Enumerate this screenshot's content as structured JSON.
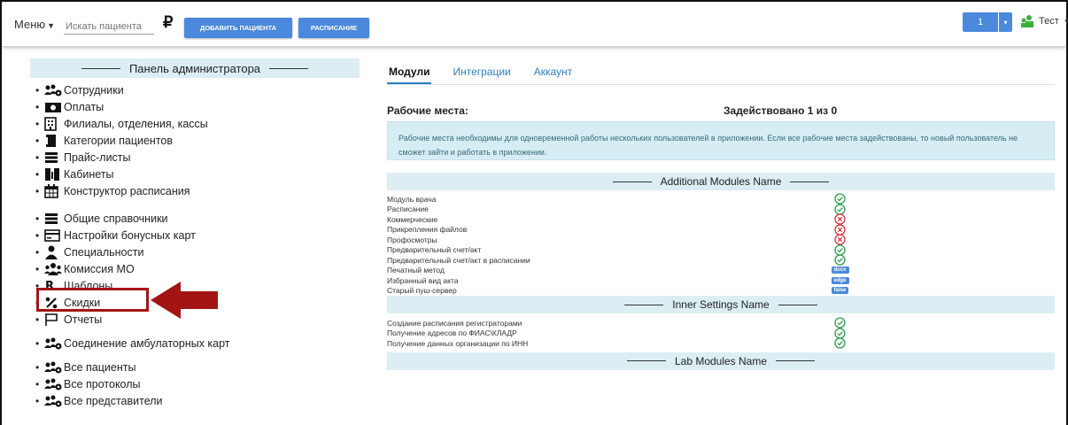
{
  "topbar": {
    "menu_label": "Меню",
    "search_placeholder": "Искать пациента",
    "currency_symbol": "₽",
    "add_patient_label": "ДОБАВИТЬ ПАЦИЕНТА",
    "schedule_label": "РАСПИСАНИЕ",
    "counter_value": "1",
    "user_name": "Тест"
  },
  "sidebar": {
    "title": "Панель администратора",
    "items": [
      {
        "label": "Сотрудники",
        "icon": "users-cog-icon"
      },
      {
        "label": "Оплаты",
        "icon": "money-icon"
      },
      {
        "label": "Филиалы, отделения, кассы",
        "icon": "building-icon"
      },
      {
        "label": "Категории пациентов",
        "icon": "file-icon"
      },
      {
        "label": "Прайс-листы",
        "icon": "list-icon"
      },
      {
        "label": "Кабинеты",
        "icon": "door-icon"
      },
      {
        "label": "Конструктор расписания",
        "icon": "calendar-icon"
      },
      {
        "label": "Общие справочники",
        "icon": "list-icon"
      },
      {
        "label": "Настройки бонусных карт",
        "icon": "card-icon"
      },
      {
        "label": "Специальности",
        "icon": "doctor-icon"
      },
      {
        "label": "Комиссия МО",
        "icon": "users-icon"
      },
      {
        "label": "Шаблоны",
        "icon": "prescription-icon"
      },
      {
        "label": "Скидки",
        "icon": "percent-icon"
      },
      {
        "label": "Отчеты",
        "icon": "flag-icon"
      },
      {
        "label": "Соединение амбулаторных карт",
        "icon": "users-cog-icon"
      },
      {
        "label": "Все пациенты",
        "icon": "users-cog-icon"
      },
      {
        "label": "Все протоколы",
        "icon": "users-cog-icon"
      },
      {
        "label": "Все представители",
        "icon": "users-cog-icon"
      }
    ]
  },
  "tabs": [
    {
      "label": "Модули",
      "active": true
    },
    {
      "label": "Интеграции",
      "active": false
    },
    {
      "label": "Аккаунт",
      "active": false
    }
  ],
  "workplaces": {
    "label": "Рабочие места:",
    "used": "Задействовано 1 из 0",
    "info": "Рабочие места необходимы для одновременной работы нескольких пользователей в приложении. Если все рабочие места задействованы, то новый пользователь не сможет зайти и работать в приложении."
  },
  "additional_modules": {
    "title": "Additional Modules Name",
    "rows": [
      {
        "name": "Модуль врача",
        "status": "ok"
      },
      {
        "name": "Расписание",
        "status": "ok"
      },
      {
        "name": "Коммерческие",
        "status": "error"
      },
      {
        "name": "Прикрепления файлов",
        "status": "error"
      },
      {
        "name": "Профосмотры",
        "status": "error"
      },
      {
        "name": "Предварительный счет/акт",
        "status": "ok"
      },
      {
        "name": "Предварительный счет/акт в расписании",
        "status": "ok"
      },
      {
        "name": "Печатный метод",
        "status": "tag",
        "tag": "docx"
      },
      {
        "name": "Избранный вид акта",
        "status": "tag",
        "tag": "edge"
      },
      {
        "name": "Старый пуш-сервер",
        "status": "tag",
        "tag": "false"
      }
    ]
  },
  "inner_settings": {
    "title": "Inner Settings Name",
    "rows": [
      {
        "name": "Создание расписания регистраторами",
        "status": "ok"
      },
      {
        "name": "Получение адресов по ФИАС\\КЛАДР",
        "status": "ok"
      },
      {
        "name": "Получение данных организации по ИНН",
        "status": "ok"
      }
    ]
  },
  "lab_modules": {
    "title": "Lab Modules Name"
  },
  "colors": {
    "accent": "#4a89dc",
    "ok": "#2e9e4f",
    "error": "#d9333f",
    "highlight": "#a31515",
    "section_bg": "#dceef3"
  }
}
